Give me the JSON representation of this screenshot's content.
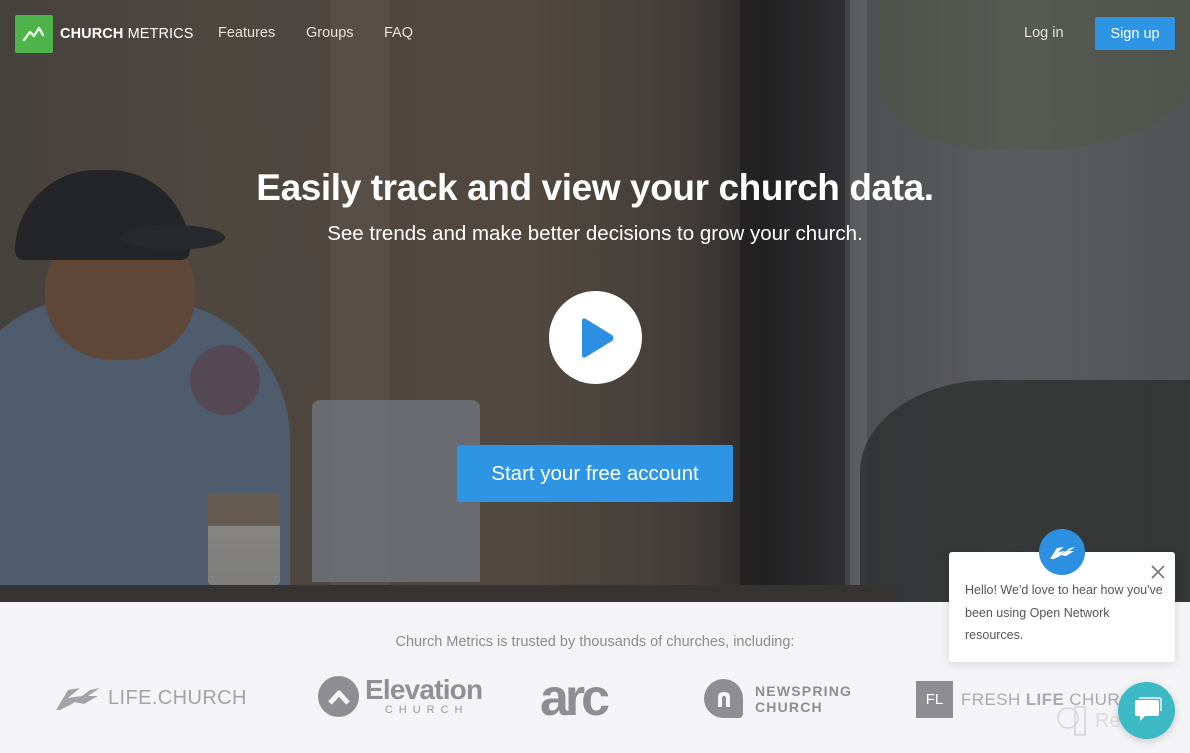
{
  "nav": {
    "brand_bold": "CHURCH",
    "brand_light": " METRICS",
    "links": [
      {
        "label": "Features"
      },
      {
        "label": "Groups"
      },
      {
        "label": "FAQ"
      }
    ],
    "login_label": "Log in",
    "signup_label": "Sign up"
  },
  "hero": {
    "headline": "Easily track and view your church data.",
    "subhead": "See trends and make better decisions to grow your church.",
    "play_icon": "play-icon",
    "cta_label": "Start your free account"
  },
  "trust": {
    "text": "Church Metrics is trusted by thousands of churches, including:",
    "churches": [
      {
        "name": "LIFE.CHURCH"
      },
      {
        "name": "Elevation",
        "sub": "CHURCH"
      },
      {
        "name": "arc"
      },
      {
        "name_line1": "NEWSPRING",
        "name_line2": "CHURCH"
      },
      {
        "badge": "FL",
        "name_light": "FRESH ",
        "name_bold": "LIFE",
        "name_tail": " CHURC"
      }
    ]
  },
  "chat": {
    "message": "Hello! We'd love to hear how you've been using Open Network resources.",
    "close_icon": "close-icon",
    "launcher_icon": "chat-bubble-icon"
  },
  "watermark": {
    "text": "Revain"
  },
  "colors": {
    "brand_green": "#4db34a",
    "primary_blue": "#2d95e3",
    "chat_teal": "#3cb9c4",
    "logo_gray": "#8e8e90"
  }
}
